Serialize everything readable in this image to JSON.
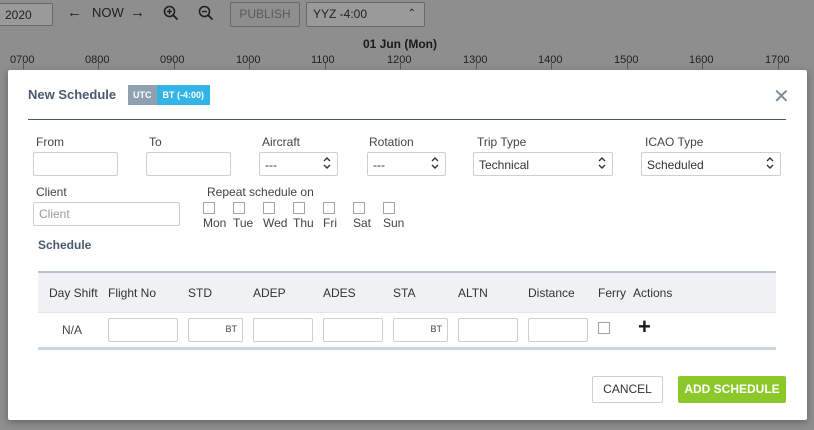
{
  "background": {
    "date_value": "2020",
    "now_label": "NOW",
    "publish_label": "PUBLISH",
    "timezone_value": "YYZ -4:00",
    "date_title": "01 Jun (Mon)",
    "hours": [
      "0700",
      "0800",
      "0900",
      "1000",
      "1100",
      "1200",
      "1300",
      "1400",
      "1500",
      "1600",
      "1700"
    ]
  },
  "modal": {
    "title": "New Schedule",
    "tz_utc": "UTC",
    "tz_bt": "BT (-4:00)",
    "close_icon": "close-icon",
    "form": {
      "from_label": "From",
      "from_value": "",
      "to_label": "To",
      "to_value": "",
      "aircraft_label": "Aircraft",
      "aircraft_value": "---",
      "rotation_label": "Rotation",
      "rotation_value": "---",
      "trip_type_label": "Trip Type",
      "trip_type_value": "Technical",
      "icao_type_label": "ICAO Type",
      "icao_type_value": "Scheduled",
      "client_label": "Client",
      "client_placeholder": "Client",
      "repeat_label": "Repeat schedule on",
      "days": [
        "Mon",
        "Tue",
        "Wed",
        "Thu",
        "Fri",
        "Sat",
        "Sun"
      ]
    },
    "schedule_heading": "Schedule",
    "table": {
      "headers": [
        "Day Shift",
        "Flight No",
        "STD",
        "ADEP",
        "ADES",
        "STA",
        "ALTN",
        "Distance",
        "Ferry",
        "Actions"
      ],
      "row": {
        "day_shift": "N/A",
        "std_suffix": "BT",
        "sta_suffix": "BT"
      }
    },
    "cancel_label": "CANCEL",
    "add_label": "ADD SCHEDULE"
  },
  "colors": {
    "accent_green": "#8cc82a",
    "tz_blue": "#33b4e6",
    "tz_grey": "#8fa0b0",
    "title_slate": "#4a5a6e"
  }
}
